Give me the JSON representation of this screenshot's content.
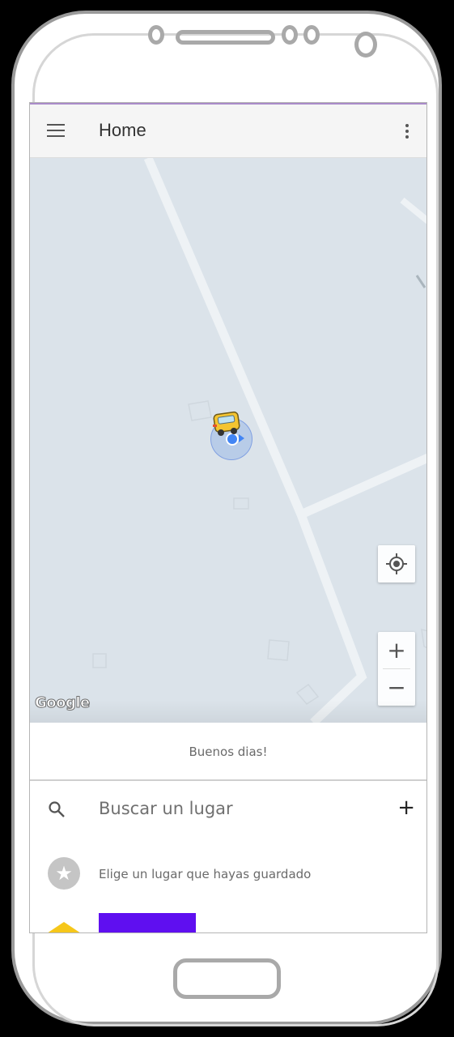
{
  "app_bar": {
    "title": "Home",
    "menu_icon": "menu-icon",
    "overflow_icon": "more-vert-icon"
  },
  "map": {
    "provider_logo": "Google",
    "my_location_icon": "my-location-icon",
    "zoom_in_label": "+",
    "zoom_out_label": "−",
    "bus_marker_icon": "bus-icon",
    "user_location_icon": "location-dot-icon"
  },
  "greeting": {
    "text": "Buenos dias!"
  },
  "search_row": {
    "label": "Buscar un lugar",
    "icon": "search-icon",
    "add_label": "+"
  },
  "saved_row": {
    "label": "Elige un lugar que hayas guardado",
    "icon": "star-icon"
  },
  "colors": {
    "map_background": "#dbe3ea",
    "accent_purple": "#5f0ff0",
    "accent_yellow": "#f6c71a",
    "location_dot": "#4285f4"
  }
}
